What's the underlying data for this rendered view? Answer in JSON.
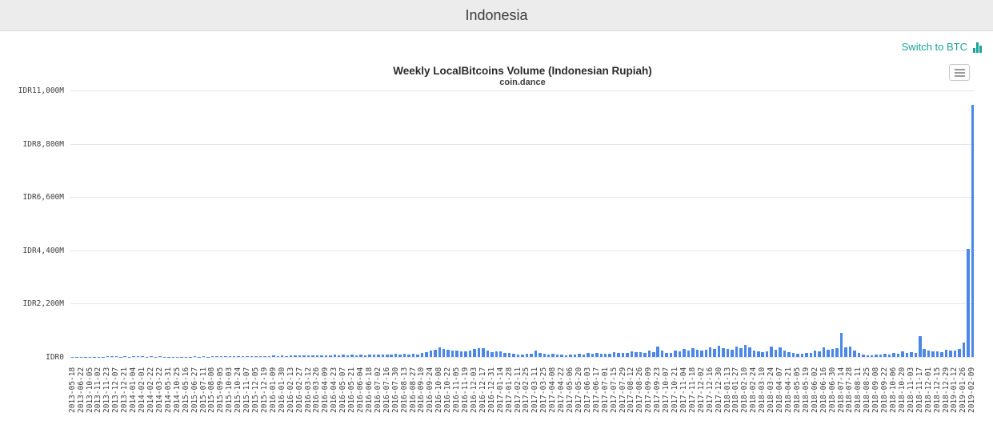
{
  "page": {
    "title": "Indonesia"
  },
  "toolbar": {
    "switch_label": "Switch to BTC",
    "accent_teal": "#1aa29a"
  },
  "export_menu": {
    "icon": "hamburger-menu-icon"
  },
  "chart_data": {
    "type": "bar",
    "title": "Weekly LocalBitcoins Volume (Indonesian Rupiah)",
    "subtitle": "coin.dance",
    "xlabel": "",
    "ylabel": "",
    "unit": "IDR millions",
    "ylim": [
      0,
      11000
    ],
    "y_ticks": [
      "IDR11,000M",
      "IDR8,800M",
      "IDR6,600M",
      "IDR4,400M",
      "IDR2,200M",
      "IDR0"
    ],
    "y_tick_values": [
      11000,
      8800,
      6600,
      4400,
      2200,
      0
    ],
    "grid": true,
    "legend": "none",
    "bar_color": "#4a87e8",
    "label_step": 2,
    "categories": [
      "2013-05-18",
      "2013-06-22",
      "2013-10-05",
      "2013-11-02",
      "2013-11-23",
      "2013-12-07",
      "2013-12-21",
      "2014-01-04",
      "2014-02-01",
      "2014-02-22",
      "2014-03-22",
      "2014-05-31",
      "2014-10-25",
      "2015-05-16",
      "2015-06-27",
      "2015-07-11",
      "2015-08-08",
      "2015-09-05",
      "2015-10-03",
      "2015-10-24",
      "2015-11-07",
      "2015-12-05",
      "2015-12-19",
      "2016-01-09",
      "2016-01-30",
      "2016-02-13",
      "2016-02-27",
      "2016-03-12",
      "2016-03-26",
      "2016-04-09",
      "2016-04-23",
      "2016-05-07",
      "2016-05-21",
      "2016-06-04",
      "2016-06-18",
      "2016-07-02",
      "2016-07-16",
      "2016-07-30",
      "2016-08-13",
      "2016-08-27",
      "2016-09-10",
      "2016-09-24",
      "2016-10-08",
      "2016-10-22",
      "2016-11-05",
      "2016-11-19",
      "2016-12-03",
      "2016-12-17",
      "2016-12-31",
      "2017-01-14",
      "2017-01-28",
      "2017-02-11",
      "2017-02-25",
      "2017-03-11",
      "2017-03-25",
      "2017-04-08",
      "2017-04-22",
      "2017-05-06",
      "2017-05-20",
      "2017-06-03",
      "2017-06-17",
      "2017-07-01",
      "2017-07-15",
      "2017-07-29",
      "2017-08-12",
      "2017-08-26",
      "2017-09-09",
      "2017-09-23",
      "2017-10-07",
      "2017-10-21",
      "2017-11-04",
      "2017-11-18",
      "2017-12-02",
      "2017-12-16",
      "2017-12-30",
      "2018-01-13",
      "2018-01-27",
      "2018-02-10",
      "2018-02-24",
      "2018-03-10",
      "2018-03-24",
      "2018-04-07",
      "2018-04-21",
      "2018-05-05",
      "2018-05-19",
      "2018-06-02",
      "2018-06-16",
      "2018-06-30",
      "2018-07-14",
      "2018-07-28",
      "2018-08-11",
      "2018-08-25",
      "2018-09-08",
      "2018-09-22",
      "2018-10-06",
      "2018-10-20",
      "2018-11-03",
      "2018-11-17",
      "2018-12-01",
      "2018-12-15",
      "2018-12-29",
      "2019-01-12",
      "2019-01-26",
      "2019-02-09"
    ],
    "values": [
      10,
      4,
      6,
      3,
      5,
      3,
      15,
      8,
      40,
      18,
      25,
      12,
      30,
      15,
      45,
      20,
      38,
      16,
      30,
      12,
      22,
      8,
      12,
      5,
      8,
      4,
      14,
      7,
      18,
      9,
      25,
      12,
      40,
      20,
      45,
      28,
      30,
      24,
      35,
      28,
      40,
      30,
      38,
      32,
      45,
      36,
      50,
      40,
      55,
      45,
      60,
      50,
      65,
      55,
      70,
      58,
      75,
      62,
      80,
      66,
      85,
      70,
      90,
      74,
      95,
      78,
      100,
      82,
      105,
      86,
      110,
      90,
      115,
      95,
      120,
      100,
      130,
      108,
      140,
      115,
      160,
      200,
      260,
      310,
      390,
      330,
      300,
      270,
      260,
      240,
      230,
      280,
      330,
      350,
      360,
      280,
      200,
      220,
      230,
      180,
      150,
      120,
      100,
      110,
      130,
      120,
      260,
      180,
      140,
      110,
      120,
      100,
      90,
      80,
      110,
      95,
      130,
      115,
      150,
      130,
      170,
      140,
      120,
      135,
      200,
      160,
      180,
      150,
      230,
      190,
      210,
      170,
      250,
      200,
      430,
      280,
      180,
      160,
      260,
      220,
      330,
      280,
      360,
      300,
      260,
      290,
      390,
      340,
      460,
      380,
      330,
      290,
      430,
      360,
      490,
      400,
      280,
      240,
      200,
      230,
      420,
      300,
      390,
      280,
      200,
      170,
      140,
      130,
      160,
      150,
      260,
      220,
      390,
      300,
      340,
      380,
      1000,
      400,
      430,
      280,
      150,
      100,
      80,
      70,
      100,
      90,
      130,
      110,
      160,
      140,
      230,
      180,
      200,
      170,
      855,
      330,
      260,
      230,
      240,
      210,
      300,
      260,
      260,
      330,
      590,
      4470,
      10400
    ]
  }
}
